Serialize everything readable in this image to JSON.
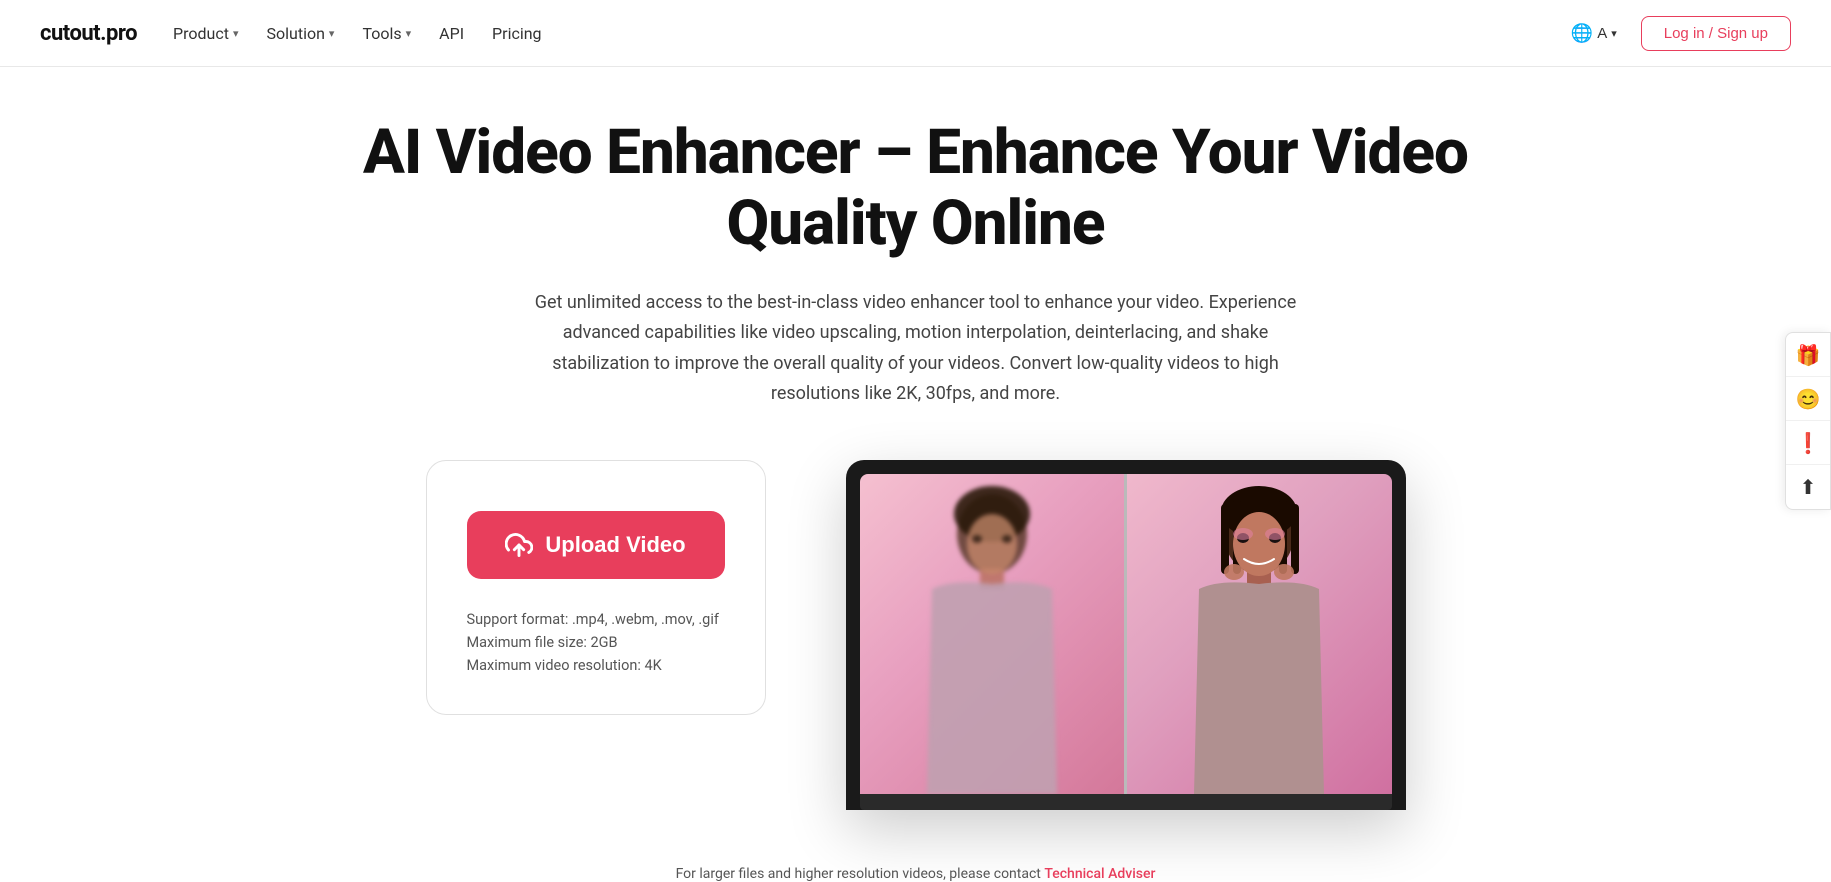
{
  "brand": {
    "logo": "cutout.pro"
  },
  "nav": {
    "items": [
      {
        "label": "Product",
        "hasDropdown": true
      },
      {
        "label": "Solution",
        "hasDropdown": true
      },
      {
        "label": "Tools",
        "hasDropdown": true
      },
      {
        "label": "API",
        "hasDropdown": false
      },
      {
        "label": "Pricing",
        "hasDropdown": false
      }
    ],
    "lang_label": "A",
    "login_label": "Log in / Sign up"
  },
  "hero": {
    "title": "AI Video Enhancer – Enhance Your Video Quality Online",
    "description": "Get unlimited access to the best-in-class video enhancer tool to enhance your video. Experience advanced capabilities like video upscaling, motion interpolation, deinterlacing, and shake stabilization to improve the overall quality of your videos. Convert low-quality videos to high resolutions like 2K, 30fps, and more."
  },
  "upload_card": {
    "button_label": "Upload Video",
    "format_label": "Support format: .mp4, .webm, .mov, .gif",
    "size_label": "Maximum file size: 2GB",
    "resolution_label": "Maximum video resolution: 4K"
  },
  "footer_note": {
    "text": "For larger files and higher resolution videos, please contact ",
    "link_label": "Technical Adviser"
  },
  "sidebar": {
    "icons": [
      {
        "name": "gift-icon",
        "symbol": "🎁"
      },
      {
        "name": "face-icon",
        "symbol": "😊"
      },
      {
        "name": "alert-icon",
        "symbol": "❗"
      },
      {
        "name": "upload-top-icon",
        "symbol": "⬆"
      }
    ]
  }
}
